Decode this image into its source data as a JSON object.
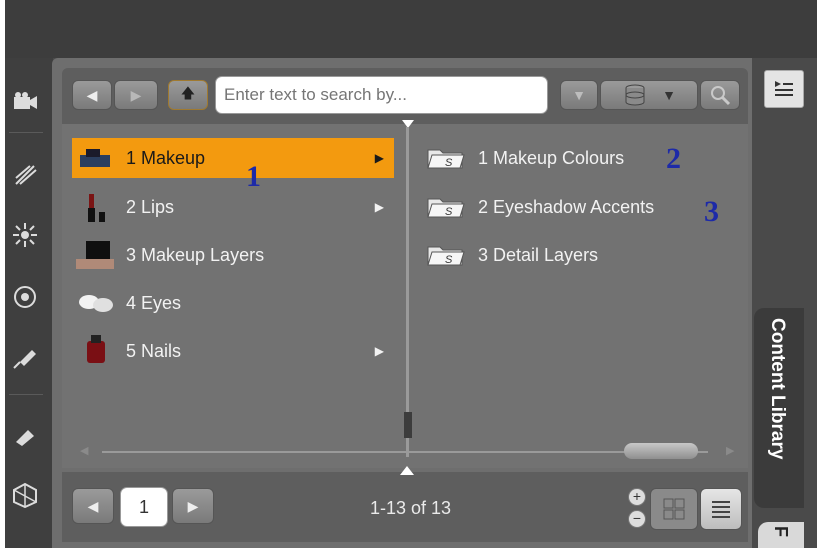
{
  "toolbar": {
    "back_icon": "arrow-left-icon",
    "forward_icon": "arrow-right-icon",
    "up_icon": "arrow-up-icon",
    "search_placeholder": "Enter text to search by...",
    "database_icon": "database-icon",
    "search_icon": "magnifier-icon"
  },
  "left_list": [
    {
      "label": "1 Makeup",
      "selected": true,
      "has_children": true
    },
    {
      "label": "2 Lips",
      "selected": false,
      "has_children": true
    },
    {
      "label": "3 Makeup Layers",
      "selected": false,
      "has_children": false
    },
    {
      "label": "4 Eyes",
      "selected": false,
      "has_children": false
    },
    {
      "label": "5 Nails",
      "selected": false,
      "has_children": true
    }
  ],
  "right_list": [
    {
      "label": "1 Makeup Colours"
    },
    {
      "label": "2 Eyeshadow Accents"
    },
    {
      "label": "3 Detail Layers"
    }
  ],
  "annotations": [
    "1",
    "2",
    "3"
  ],
  "pagination": {
    "page": "1",
    "range": "1-13 of 13"
  },
  "side_tab": {
    "label": "Content Library",
    "next_label": "F"
  },
  "colors": {
    "selected": "#f39a0f",
    "annotation": "#1d2aa8"
  }
}
